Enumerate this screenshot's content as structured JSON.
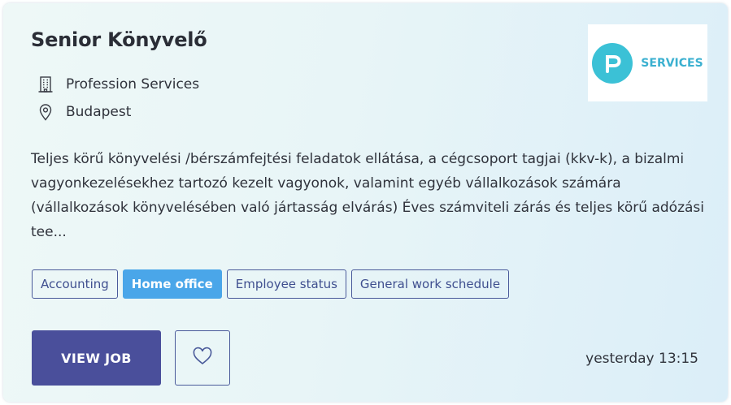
{
  "job": {
    "title": "Senior Könyvelő",
    "company": "Profession Services",
    "location": "Budapest",
    "description": "Teljes körű könyvelési /bérszámfejtési feladatok ellátása, a cégcsoport tagjai (kkv-k), a bizalmi vagyonkezelésekhez tartozó kezelt vagyonok, valamint egyéb vállalkozások számára (vállalkozások könyvelésében való jártasság elvárás) Éves számviteli zárás és teljes körű adózási tee...",
    "posted": "yesterday 13:15"
  },
  "logo": {
    "text": "SERVICES",
    "letter": "P",
    "color": "#3bc1d6"
  },
  "tags": [
    {
      "label": "Accounting",
      "active": false
    },
    {
      "label": "Home office",
      "active": true
    },
    {
      "label": "Employee status",
      "active": false
    },
    {
      "label": "General work schedule",
      "active": false
    }
  ],
  "actions": {
    "view_label": "VIEW JOB",
    "favorite_icon": "heart-icon"
  },
  "colors": {
    "primary": "#4a4f9b",
    "accent": "#4aa6e9",
    "border": "#4a5a9a"
  }
}
